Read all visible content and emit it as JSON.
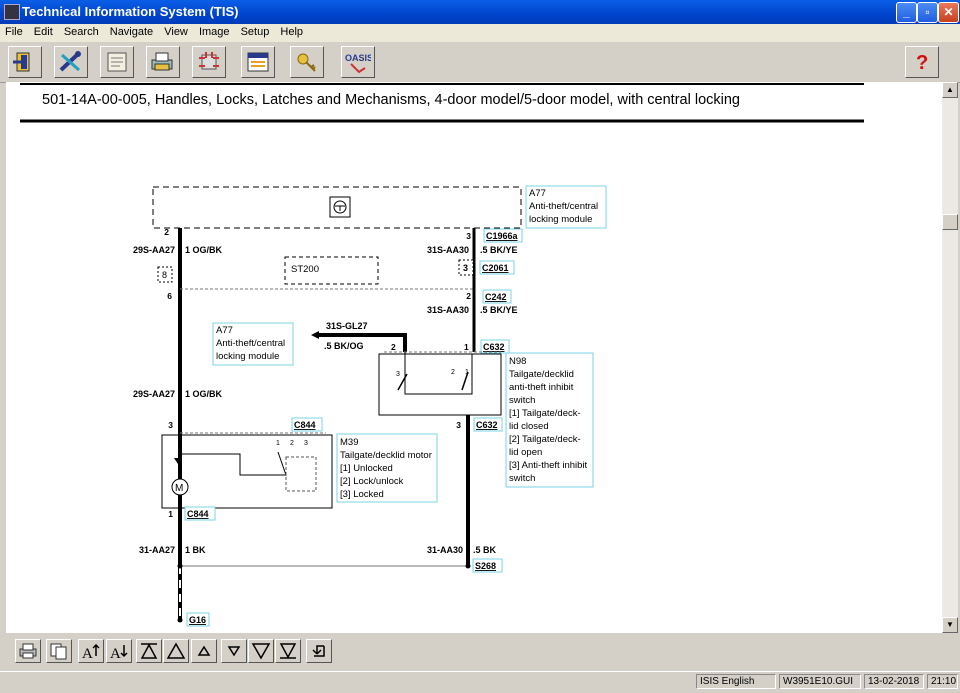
{
  "window": {
    "title": "Technical Information System (TIS)"
  },
  "menu": [
    "File",
    "Edit",
    "Search",
    "Navigate",
    "View",
    "Image",
    "Setup",
    "Help"
  ],
  "toolbar": {
    "icons": [
      "exit-icon",
      "tools-icon",
      "notes-icon",
      "printer-icon",
      "network-icon",
      "calendar-icon",
      "key-icon",
      "oasis-icon",
      "help-icon"
    ],
    "oasis_label": "OASIS",
    "help_label": "?"
  },
  "document": {
    "title": "501-14A-00-005, Handles, Locks, Latches and Mechanisms, 4-door model/5-door model, with central locking"
  },
  "diagram": {
    "module_a77_top": {
      "code": "A77",
      "line1": "Anti-theft/central",
      "line2": "locking module"
    },
    "module_a77_left": {
      "code": "A77",
      "line1": "Anti-theft/central",
      "line2": "locking module"
    },
    "n98": {
      "code": "N98",
      "lines": [
        "Tailgate/decklid",
        "anti-theft inhibit",
        "switch",
        "[1] Tailgate/deck-",
        "lid closed",
        "[2] Tailgate/deck-",
        "lid open",
        "[3] Anti-theft inhibit",
        "switch"
      ]
    },
    "m39": {
      "code": "M39",
      "lines": [
        "Tailgate/decklid motor",
        "[1] Unlocked",
        "[2] Lock/unlock",
        "[3] Locked"
      ]
    },
    "connectors": {
      "c1966a": "C1966a",
      "c2061": "C2061",
      "c242": "C242",
      "c632_top": "C632",
      "c632_bottom": "C632",
      "c844_top": "C844",
      "c844_bottom": "C844",
      "s268": "S268",
      "g16": "G16"
    },
    "splice": "ST200",
    "wires": {
      "left_top_id": "29S-AA27",
      "left_top_color": "1 OG/BK",
      "left_mid_id": "29S-AA27",
      "left_mid_color": "1 OG/BK",
      "left_bottom_id": "31-AA27",
      "left_bottom_color": "1 BK",
      "right_top_id": "31S-AA30",
      "right_top_color": ".5 BK/YE",
      "right_mid_id": "31S-AA30",
      "right_mid_color": ".5 BK/YE",
      "right_bottom_id": "31-AA30",
      "right_bottom_color": ".5 BK",
      "gl_id": "31S-GL27",
      "gl_color": ".5 BK/OG"
    },
    "pins": {
      "p2_left": "2",
      "p3_top": "3",
      "p8": "8",
      "p3_c2061": "3",
      "p6": "6",
      "p2_c242": "2",
      "p2_n98": "2",
      "p1_n98": "1",
      "p3_m39": "3",
      "p3_c632": "3",
      "p1_m39": "1",
      "sw_n98_3": "3",
      "sw_n98_2": "2",
      "sw_n98_1": "1",
      "sw_m39_1": "1",
      "sw_m39_2": "2",
      "sw_m39_3": "3"
    },
    "motor_symbol": "M"
  },
  "bottom_toolbar": {
    "icons": [
      "print-icon",
      "copy-icon",
      "font-larger-icon",
      "font-smaller-icon",
      "first-page-icon",
      "page-up-icon",
      "line-up-icon",
      "line-down-icon",
      "page-down-icon",
      "last-page-icon",
      "back-icon"
    ]
  },
  "status": {
    "language": "ISIS English",
    "file": "W3951E10.GUI",
    "date": "13-02-2018",
    "time": "21:10"
  },
  "colors": {
    "titlebar": "#0a5fe6",
    "label_border": "#7ad3e6",
    "panel": "#d4d0c8"
  }
}
